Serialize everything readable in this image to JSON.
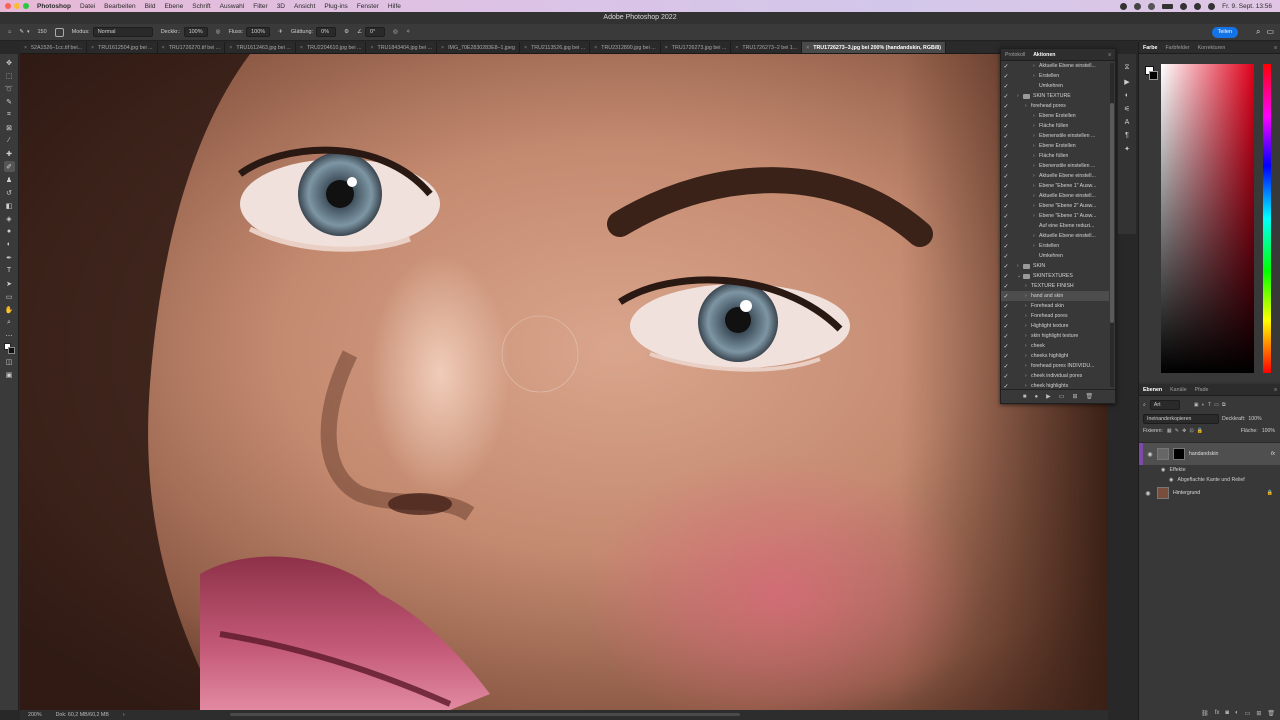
{
  "menubar": {
    "app": "Photoshop",
    "items": [
      "Datei",
      "Bearbeiten",
      "Bild",
      "Ebene",
      "Schrift",
      "Auswahl",
      "Filter",
      "3D",
      "Ansicht",
      "Plug-ins",
      "Fenster",
      "Hilfe"
    ],
    "clock": "Fr. 9. Sept. 13:56"
  },
  "window": {
    "title": "Adobe Photoshop 2022"
  },
  "options": {
    "size": "150",
    "mode_label": "Modus:",
    "mode_value": "Normal",
    "opacity_label": "Deckkr.:",
    "opacity_value": "100%",
    "flow_label": "Fluss:",
    "flow_value": "100%",
    "smoothing_label": "Glättung:",
    "smoothing_value": "0%",
    "angle_value": "0°",
    "share": "Teilen"
  },
  "tabs": [
    "52A1526–1cc.tif bei...",
    "TRU1612504.jpg bei ...",
    "TRU1726270.tif bei ...",
    "TRU1612463.jpg bei ...",
    "TRU2204610.jpg bei ...",
    "TRU1843404.jpg bei ...",
    "IMG_70E2830283E8–1.jpeg",
    "TRU2113526.jpg bei ...",
    "TRU2312890.jpg bei ...",
    "TRU1726273.jpg bei ...",
    "TRU1726273–2 bei 1...",
    "TRU1726273–3.jpg bei 200% (handandskin, RGB/8)"
  ],
  "active_tab_index": 11,
  "status": {
    "zoom": "200%",
    "doc": "Dok: 60,2 MB/60,2 MB"
  },
  "actions_panel": {
    "tabs": [
      "Protokoll",
      "Aktionen"
    ],
    "rows": [
      {
        "indent": 2,
        "type": "item",
        "label": "Aktuelle Ebene einstell..."
      },
      {
        "indent": 2,
        "type": "item",
        "label": "Erstellen"
      },
      {
        "indent": 2,
        "type": "plain",
        "label": "Umkehren"
      },
      {
        "indent": 0,
        "type": "set",
        "label": "SKIN TEXTURE"
      },
      {
        "indent": 1,
        "type": "action",
        "label": "forehead pores"
      },
      {
        "indent": 2,
        "type": "item",
        "label": "Ebene Erstellen"
      },
      {
        "indent": 2,
        "type": "item",
        "label": "Fläche füllen"
      },
      {
        "indent": 2,
        "type": "item",
        "label": "Ebenenstile einstellen ..."
      },
      {
        "indent": 2,
        "type": "item",
        "label": "Ebene Erstellen"
      },
      {
        "indent": 2,
        "type": "item",
        "label": "Fläche füllen"
      },
      {
        "indent": 2,
        "type": "item",
        "label": "Ebenenstile einstellen ..."
      },
      {
        "indent": 2,
        "type": "item",
        "label": "Aktuelle Ebene einstell..."
      },
      {
        "indent": 2,
        "type": "item",
        "label": "Ebene \"Ebene 1\" Ausw..."
      },
      {
        "indent": 2,
        "type": "item",
        "label": "Aktuelle Ebene einstell..."
      },
      {
        "indent": 2,
        "type": "item",
        "label": "Ebene \"Ebene 2\" Ausw..."
      },
      {
        "indent": 2,
        "type": "item",
        "label": "Ebene \"Ebene 1\" Ausw..."
      },
      {
        "indent": 2,
        "type": "plain",
        "label": "Auf eine Ebene reduzi..."
      },
      {
        "indent": 2,
        "type": "item",
        "label": "Aktuelle Ebene einstell..."
      },
      {
        "indent": 2,
        "type": "item",
        "label": "Erstellen"
      },
      {
        "indent": 2,
        "type": "plain",
        "label": "Umkehren"
      },
      {
        "indent": 0,
        "type": "set",
        "label": "SKIN"
      },
      {
        "indent": 0,
        "type": "setopen",
        "label": "SKINTEXTURES"
      },
      {
        "indent": 1,
        "type": "action",
        "label": "TEXTURE FINISH"
      },
      {
        "indent": 1,
        "type": "action",
        "label": "hand and skin",
        "selected": true
      },
      {
        "indent": 1,
        "type": "action",
        "label": "Forehead skin"
      },
      {
        "indent": 1,
        "type": "action",
        "label": "Forehead pores"
      },
      {
        "indent": 1,
        "type": "action",
        "label": "Highlight texture"
      },
      {
        "indent": 1,
        "type": "action",
        "label": "skin highlight texture"
      },
      {
        "indent": 1,
        "type": "action",
        "label": "cheek"
      },
      {
        "indent": 1,
        "type": "action",
        "label": "cheeks highlight"
      },
      {
        "indent": 1,
        "type": "action",
        "label": "forehead pores INDIVIDU..."
      },
      {
        "indent": 1,
        "type": "action",
        "label": "cheek individual pores"
      },
      {
        "indent": 1,
        "type": "action",
        "label": "cheek highlights"
      }
    ]
  },
  "color_panel": {
    "tabs": [
      "Farbe",
      "Farbfelder",
      "Korrekturen"
    ],
    "fg": "#ffffff",
    "bg": "#000000",
    "hue": "#e0001a"
  },
  "layers_panel": {
    "tabs": [
      "Ebenen",
      "Kanäle",
      "Pfade"
    ],
    "filter_kind": "Art",
    "blend_mode": "Ineinanderkopieren",
    "opacity_label": "Deckkraft:",
    "opacity_value": "100%",
    "lock_label": "Fixieren:",
    "fill_label": "Fläche:",
    "fill_value": "100%",
    "layers": [
      {
        "name": "handandskin",
        "active": true,
        "fx": "fx"
      },
      {
        "name": "Hintergrund",
        "active": false
      }
    ],
    "effects_label": "Effekte",
    "effect_name": "Abgeflachte Kante und Relief"
  }
}
